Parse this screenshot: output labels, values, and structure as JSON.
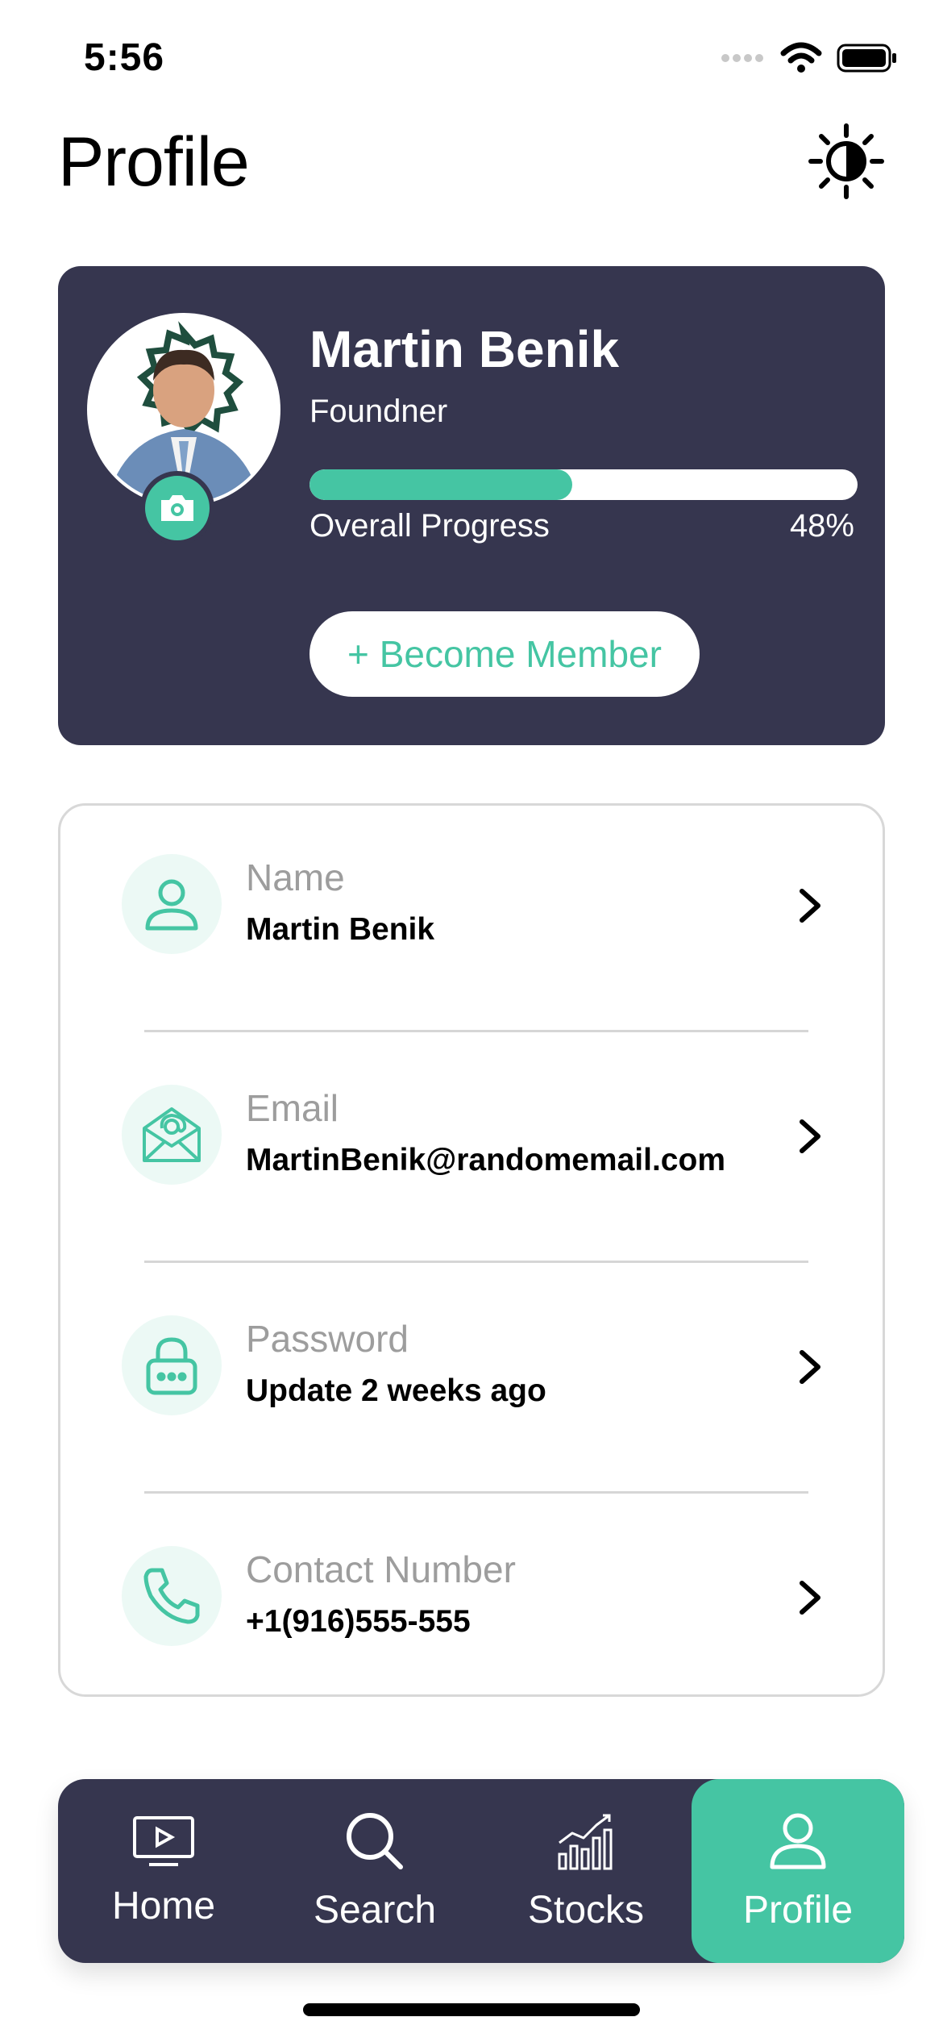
{
  "status_bar": {
    "time": "5:56"
  },
  "header": {
    "title": "Profile"
  },
  "profile": {
    "name": "Martin Benik",
    "role": "Foundner",
    "progress_label": "Overall Progress",
    "progress_text": "48%",
    "progress_fraction": 0.48,
    "member_button": "+ Become Member"
  },
  "info": [
    {
      "label": "Name",
      "value": "Martin Benik",
      "icon": "user-icon"
    },
    {
      "label": "Email",
      "value": "MartinBenik@randomemail.com",
      "icon": "mail-icon"
    },
    {
      "label": "Password",
      "value": "Update 2 weeks ago",
      "icon": "lock-icon"
    },
    {
      "label": "Contact Number",
      "value": "+1(916)555-555",
      "icon": "phone-icon"
    }
  ],
  "tabs": [
    {
      "label": "Home",
      "icon": "tv-icon"
    },
    {
      "label": "Search",
      "icon": "search-icon"
    },
    {
      "label": "Stocks",
      "icon": "stocks-icon"
    },
    {
      "label": "Profile",
      "icon": "user-icon",
      "active": true
    }
  ],
  "colors": {
    "accent": "#45c5a3",
    "card": "#36364f",
    "label_gray": "#9d9d9d"
  }
}
